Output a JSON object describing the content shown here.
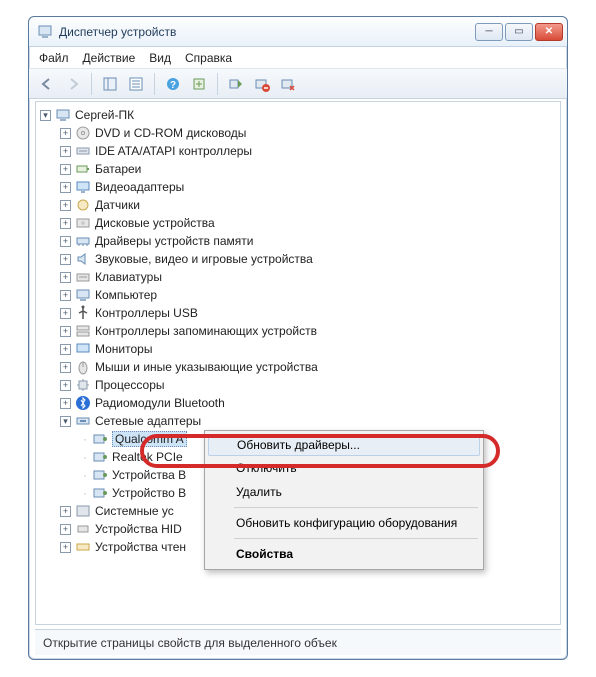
{
  "window": {
    "title": "Диспетчер устройств"
  },
  "menu": {
    "file": "Файл",
    "action": "Действие",
    "view": "Вид",
    "help": "Справка"
  },
  "root": "Сергей-ПК",
  "categories": [
    "DVD и CD-ROM дисководы",
    "IDE ATA/ATAPI контроллеры",
    "Батареи",
    "Видеоадаптеры",
    "Датчики",
    "Дисковые устройства",
    "Драйверы устройств памяти",
    "Звуковые, видео и игровые устройства",
    "Клавиатуры",
    "Компьютер",
    "Контроллеры USB",
    "Контроллеры запоминающих устройств",
    "Мониторы",
    "Мыши и иные указывающие устройства",
    "Процессоры",
    "Радиомодули Bluetooth",
    "Сетевые адаптеры"
  ],
  "net_adapters": {
    "selected": "Qualcomm A",
    "items": [
      "Realtek PCIe",
      "Устройства B",
      "Устройство B"
    ]
  },
  "tail_categories": [
    "Системные ус",
    "Устройства HID",
    "Устройства чтен"
  ],
  "context": {
    "update": "Обновить драйверы...",
    "disable": "Отключить",
    "delete": "Удалить",
    "refresh": "Обновить конфигурацию оборудования",
    "properties": "Свойства"
  },
  "status": "Открытие страницы свойств для выделенного объек"
}
